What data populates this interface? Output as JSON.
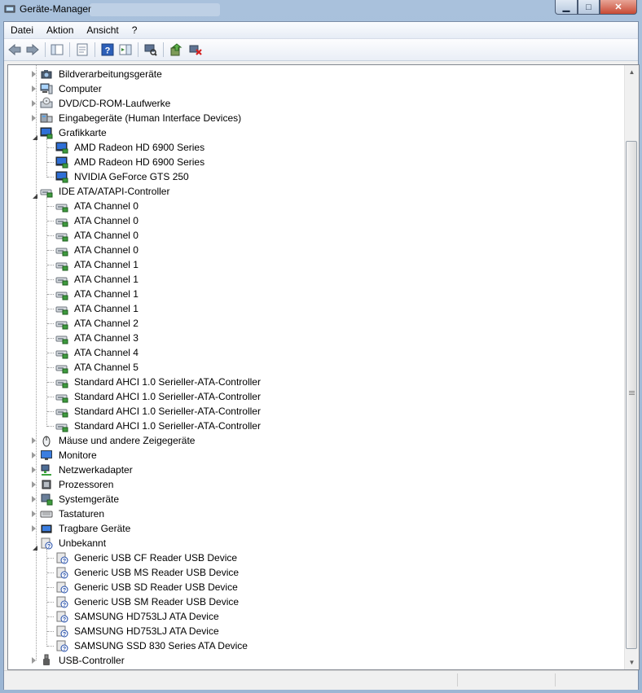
{
  "window": {
    "title": "Geräte-Manager",
    "minimize_label": "▁",
    "maximize_label": "□",
    "close_label": "✕"
  },
  "menu": [
    "Datei",
    "Aktion",
    "Ansicht",
    "?"
  ],
  "toolbar": {
    "buttons": [
      "back-icon",
      "forward-icon",
      "console-tree-icon",
      "properties-icon",
      "help-icon",
      "show-hide-icon",
      "scan-hardware-icon",
      "update-driver-icon",
      "uninstall-icon"
    ]
  },
  "tree": [
    {
      "level": 0,
      "label": "Bildverarbeitungsgeräte",
      "state": "collapsed",
      "icon": "camera-icon"
    },
    {
      "level": 0,
      "label": "Computer",
      "state": "collapsed",
      "icon": "computer-icon"
    },
    {
      "level": 0,
      "label": "DVD/CD-ROM-Laufwerke",
      "state": "collapsed",
      "icon": "dvd-drive-icon"
    },
    {
      "level": 0,
      "label": "Eingabegeräte (Human Interface Devices)",
      "state": "collapsed",
      "icon": "hid-icon"
    },
    {
      "level": 0,
      "label": "Grafikkarte",
      "state": "expanded",
      "icon": "display-adapter-icon"
    },
    {
      "level": 1,
      "label": "AMD Radeon HD 6900 Series",
      "icon": "display-adapter-icon"
    },
    {
      "level": 1,
      "label": "AMD Radeon HD 6900 Series",
      "icon": "display-adapter-icon"
    },
    {
      "level": 1,
      "label": "NVIDIA GeForce GTS 250",
      "icon": "display-adapter-icon"
    },
    {
      "level": 0,
      "label": "IDE ATA/ATAPI-Controller",
      "state": "expanded",
      "icon": "ide-controller-icon"
    },
    {
      "level": 1,
      "label": "ATA Channel 0",
      "icon": "ide-controller-icon"
    },
    {
      "level": 1,
      "label": "ATA Channel 0",
      "icon": "ide-controller-icon"
    },
    {
      "level": 1,
      "label": "ATA Channel 0",
      "icon": "ide-controller-icon"
    },
    {
      "level": 1,
      "label": "ATA Channel 0",
      "icon": "ide-controller-icon"
    },
    {
      "level": 1,
      "label": "ATA Channel 1",
      "icon": "ide-controller-icon"
    },
    {
      "level": 1,
      "label": "ATA Channel 1",
      "icon": "ide-controller-icon"
    },
    {
      "level": 1,
      "label": "ATA Channel 1",
      "icon": "ide-controller-icon"
    },
    {
      "level": 1,
      "label": "ATA Channel 1",
      "icon": "ide-controller-icon"
    },
    {
      "level": 1,
      "label": "ATA Channel 2",
      "icon": "ide-controller-icon"
    },
    {
      "level": 1,
      "label": "ATA Channel 3",
      "icon": "ide-controller-icon"
    },
    {
      "level": 1,
      "label": "ATA Channel 4",
      "icon": "ide-controller-icon"
    },
    {
      "level": 1,
      "label": "ATA Channel 5",
      "icon": "ide-controller-icon"
    },
    {
      "level": 1,
      "label": "Standard AHCI 1.0 Serieller-ATA-Controller",
      "icon": "ide-controller-icon"
    },
    {
      "level": 1,
      "label": "Standard AHCI 1.0 Serieller-ATA-Controller",
      "icon": "ide-controller-icon"
    },
    {
      "level": 1,
      "label": "Standard AHCI 1.0 Serieller-ATA-Controller",
      "icon": "ide-controller-icon"
    },
    {
      "level": 1,
      "label": "Standard AHCI 1.0 Serieller-ATA-Controller",
      "icon": "ide-controller-icon"
    },
    {
      "level": 0,
      "label": "Mäuse und andere Zeigegeräte",
      "state": "collapsed",
      "icon": "mouse-icon"
    },
    {
      "level": 0,
      "label": "Monitore",
      "state": "collapsed",
      "icon": "monitor-icon"
    },
    {
      "level": 0,
      "label": "Netzwerkadapter",
      "state": "collapsed",
      "icon": "network-adapter-icon"
    },
    {
      "level": 0,
      "label": "Prozessoren",
      "state": "collapsed",
      "icon": "processor-icon"
    },
    {
      "level": 0,
      "label": "Systemgeräte",
      "state": "collapsed",
      "icon": "system-devices-icon"
    },
    {
      "level": 0,
      "label": "Tastaturen",
      "state": "collapsed",
      "icon": "keyboard-icon"
    },
    {
      "level": 0,
      "label": "Tragbare Geräte",
      "state": "collapsed",
      "icon": "portable-device-icon"
    },
    {
      "level": 0,
      "label": "Unbekannt",
      "state": "expanded",
      "icon": "unknown-device-icon"
    },
    {
      "level": 1,
      "label": "Generic USB CF Reader USB Device",
      "icon": "unknown-device-icon"
    },
    {
      "level": 1,
      "label": "Generic USB MS Reader USB Device",
      "icon": "unknown-device-icon"
    },
    {
      "level": 1,
      "label": "Generic USB SD Reader USB Device",
      "icon": "unknown-device-icon"
    },
    {
      "level": 1,
      "label": "Generic USB SM Reader USB Device",
      "icon": "unknown-device-icon"
    },
    {
      "level": 1,
      "label": "SAMSUNG HD753LJ ATA Device",
      "icon": "unknown-device-icon"
    },
    {
      "level": 1,
      "label": "SAMSUNG HD753LJ ATA Device",
      "icon": "unknown-device-icon"
    },
    {
      "level": 1,
      "label": "SAMSUNG SSD 830 Series ATA Device",
      "icon": "unknown-device-icon"
    },
    {
      "level": 0,
      "label": "USB-Controller",
      "state": "collapsed",
      "icon": "usb-icon"
    }
  ]
}
